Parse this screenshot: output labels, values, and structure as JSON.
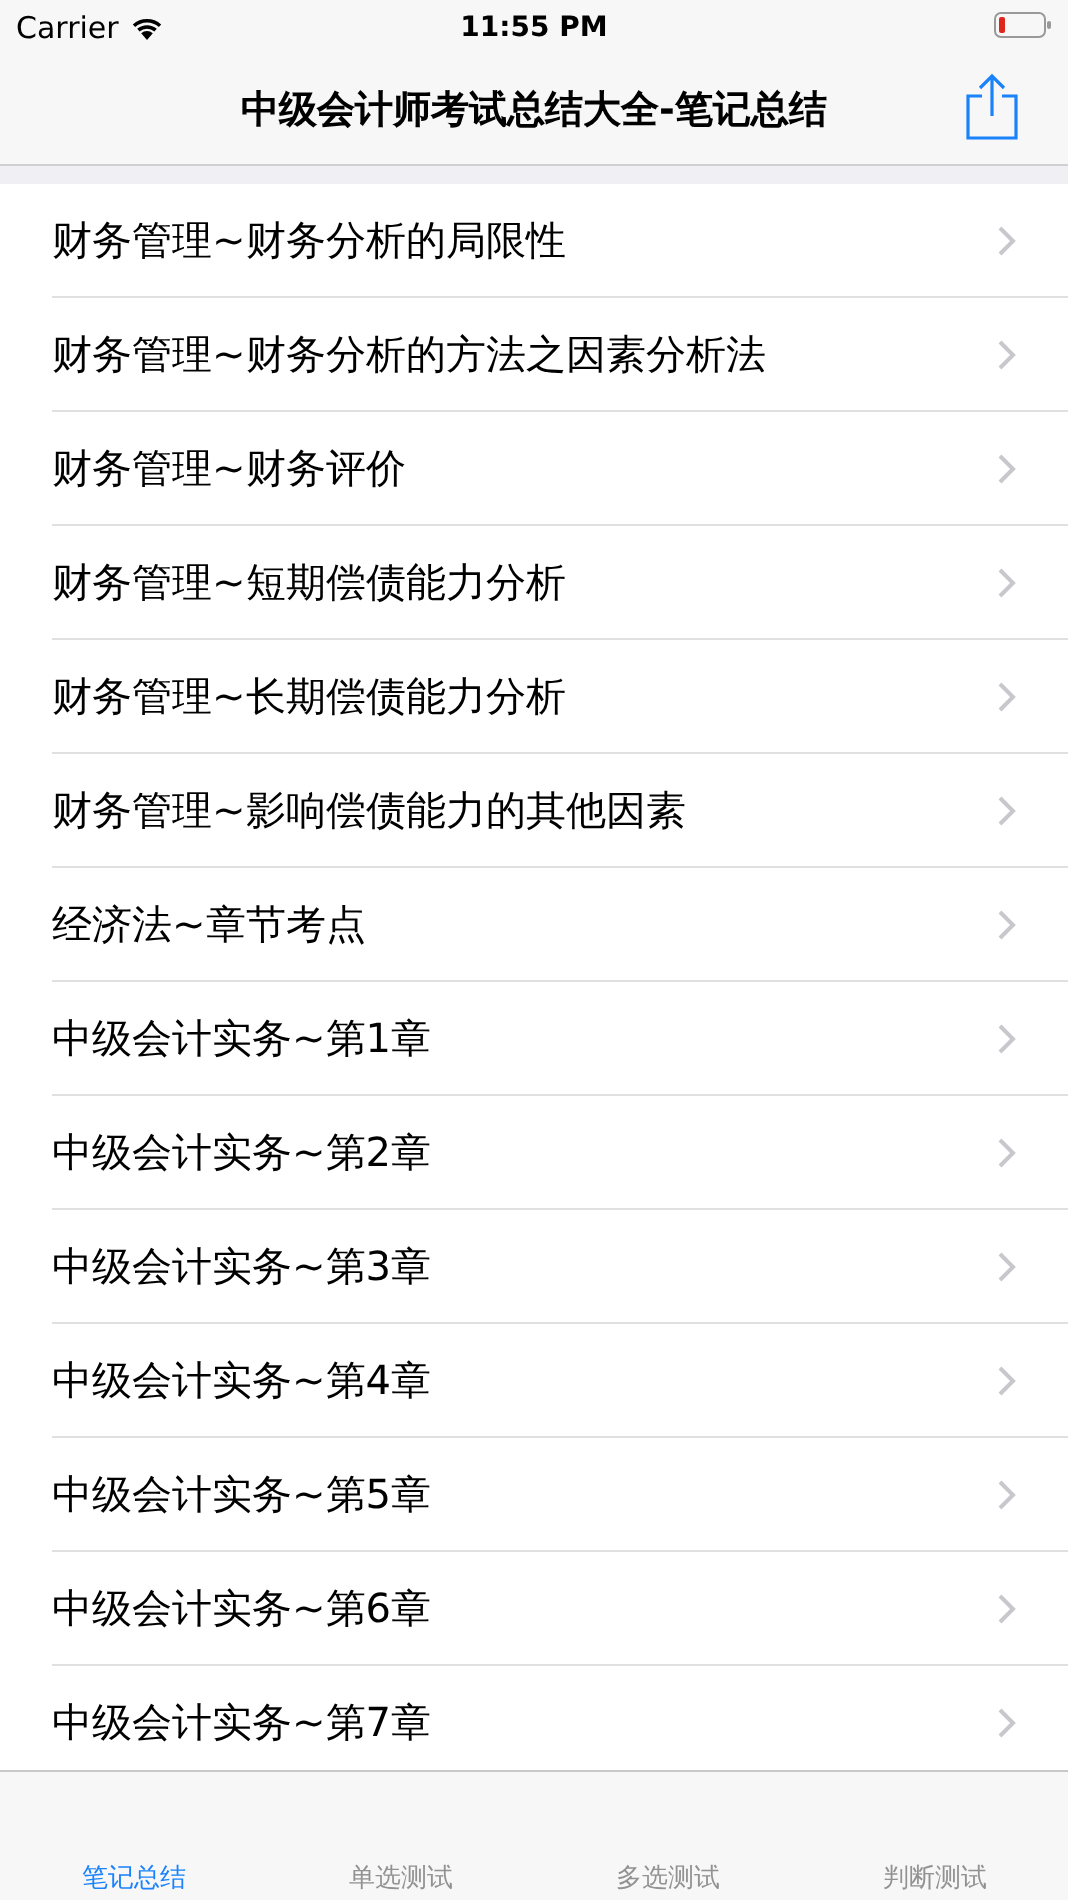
{
  "status_bar": {
    "carrier": "Carrier",
    "time": "11:55 PM"
  },
  "nav_bar": {
    "title": "中级会计师考试总结大全-笔记总结"
  },
  "list": [
    {
      "label": "财务管理~财务分析的局限性"
    },
    {
      "label": "财务管理~财务分析的方法之因素分析法"
    },
    {
      "label": "财务管理~财务评价"
    },
    {
      "label": "财务管理~短期偿债能力分析"
    },
    {
      "label": "财务管理~长期偿债能力分析"
    },
    {
      "label": "财务管理~影响偿债能力的其他因素"
    },
    {
      "label": "经济法~章节考点"
    },
    {
      "label": "中级会计实务~第1章"
    },
    {
      "label": "中级会计实务~第2章"
    },
    {
      "label": "中级会计实务~第3章"
    },
    {
      "label": "中级会计实务~第4章"
    },
    {
      "label": "中级会计实务~第5章"
    },
    {
      "label": "中级会计实务~第6章"
    },
    {
      "label": "中级会计实务~第7章"
    }
  ],
  "tab_bar": [
    {
      "label": "笔记总结",
      "selected": true
    },
    {
      "label": "单选测试",
      "selected": false
    },
    {
      "label": "多选测试",
      "selected": false
    },
    {
      "label": "判断测试",
      "selected": false
    }
  ]
}
